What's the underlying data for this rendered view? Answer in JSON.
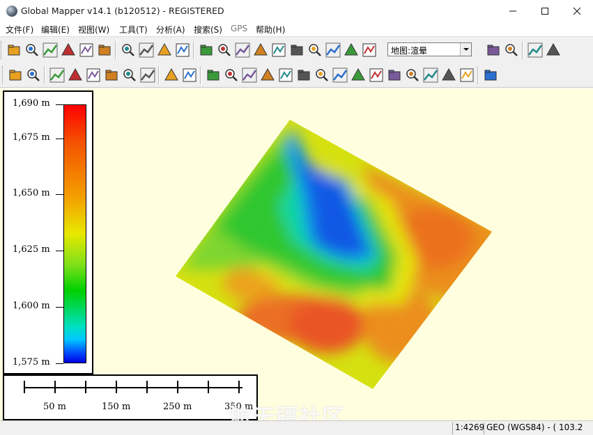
{
  "window": {
    "title": "Global Mapper v14.1 (b120512) - REGISTERED"
  },
  "menu": [
    {
      "label": "文件(F)",
      "enabled": true
    },
    {
      "label": "编辑(E)",
      "enabled": true
    },
    {
      "label": "视图(W)",
      "enabled": true
    },
    {
      "label": "工具(T)",
      "enabled": true
    },
    {
      "label": "分析(A)",
      "enabled": true
    },
    {
      "label": "搜索(S)",
      "enabled": true
    },
    {
      "label": "GPS",
      "enabled": false
    },
    {
      "label": "帮助(H)",
      "enabled": true
    }
  ],
  "toolbar": {
    "map_select_value": "地图:渲晕",
    "row1_icons": [
      "open-folder-icon",
      "save-disk-icon",
      "globe-icon",
      "layer-control-icon",
      "export-icon",
      "config-tools-icon",
      "zoom-in-icon",
      "zoom-out-icon",
      "zoom-rect-icon",
      "home-full-view-icon",
      "zoom-tool-icon",
      "pan-hand-icon",
      "measure-tool-icon",
      "feature-info-icon",
      "path-profile-icon",
      "view-shed-icon",
      "digitizer-icon",
      "elevation-query-icon",
      "tunnel-icon",
      "sunshade-icon",
      "3d-view-icon",
      "flag-icon",
      "layout-icon",
      "grid-icon"
    ],
    "row2_icons": [
      "create-area-icon",
      "create-line-icon",
      "create-contour-icon",
      "watershed-icon",
      "create-elev-grid-icon",
      "3d-code-icon",
      "combine-terrain-icon",
      "grid-layer-icon",
      "vertex-icon",
      "move-vertex-icon",
      "edit-line-icon",
      "edit-area-icon",
      "split-line-icon",
      "join-line-icon",
      "reshape-icon",
      "buffer-icon",
      "rotate-feature-icon",
      "combine-areas-icon",
      "crop-area-icon",
      "grid-cells-icon",
      "merge-features-icon",
      "area-cut-icon",
      "area-union-icon",
      "area-fill-icon",
      "path-edit-icon",
      "node-tool-icon"
    ]
  },
  "legend": {
    "title": "",
    "labels": [
      "1,690 m",
      "1,675 m",
      "1,650 m",
      "1,625 m",
      "1,600 m",
      "1,575 m"
    ],
    "min": 1575,
    "max": 1690
  },
  "scale_bar": {
    "labels": [
      "50 m",
      "150 m",
      "250 m",
      "350 m"
    ]
  },
  "watermark": "航天疆社区",
  "status": {
    "scale": "1:4269",
    "coords": "GEO (WGS84) - ( 103.2"
  },
  "colors": {
    "map_background": "#ffffe0",
    "low_elevation": "#0000e0",
    "high_elevation": "#ff0000"
  }
}
